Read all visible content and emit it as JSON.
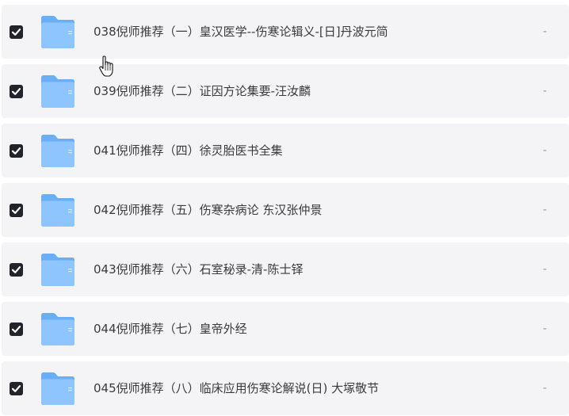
{
  "files": [
    {
      "name": "038倪师推荐（一）皇汉医学--伤寒论辑义-[日]丹波元简",
      "meta": "-",
      "checked": true
    },
    {
      "name": "039倪师推荐（二）证因方论集要-汪汝麟",
      "meta": "-",
      "checked": true
    },
    {
      "name": "041倪师推荐（四）徐灵胎医书全集",
      "meta": "-",
      "checked": true
    },
    {
      "name": "042倪师推荐（五）伤寒杂病论 东汉张仲景",
      "meta": "-",
      "checked": true
    },
    {
      "name": "043倪师推荐（六）石室秘录-清-陈士铎",
      "meta": "-",
      "checked": true
    },
    {
      "name": "044倪师推荐（七）皇帝外经",
      "meta": "-",
      "checked": true
    },
    {
      "name": "045倪师推荐（八）临床应用伤寒论解说(日) 大塚敬节",
      "meta": "-",
      "checked": true
    }
  ],
  "colors": {
    "row_bg": "#f4f4f7",
    "checkbox": "#23232b",
    "folder_front": "#8ec5ff",
    "folder_back": "#6aaef5"
  },
  "icons": {
    "checkbox": "checkmark-icon",
    "folder": "folder-icon",
    "cursor": "hand-pointer-icon"
  }
}
